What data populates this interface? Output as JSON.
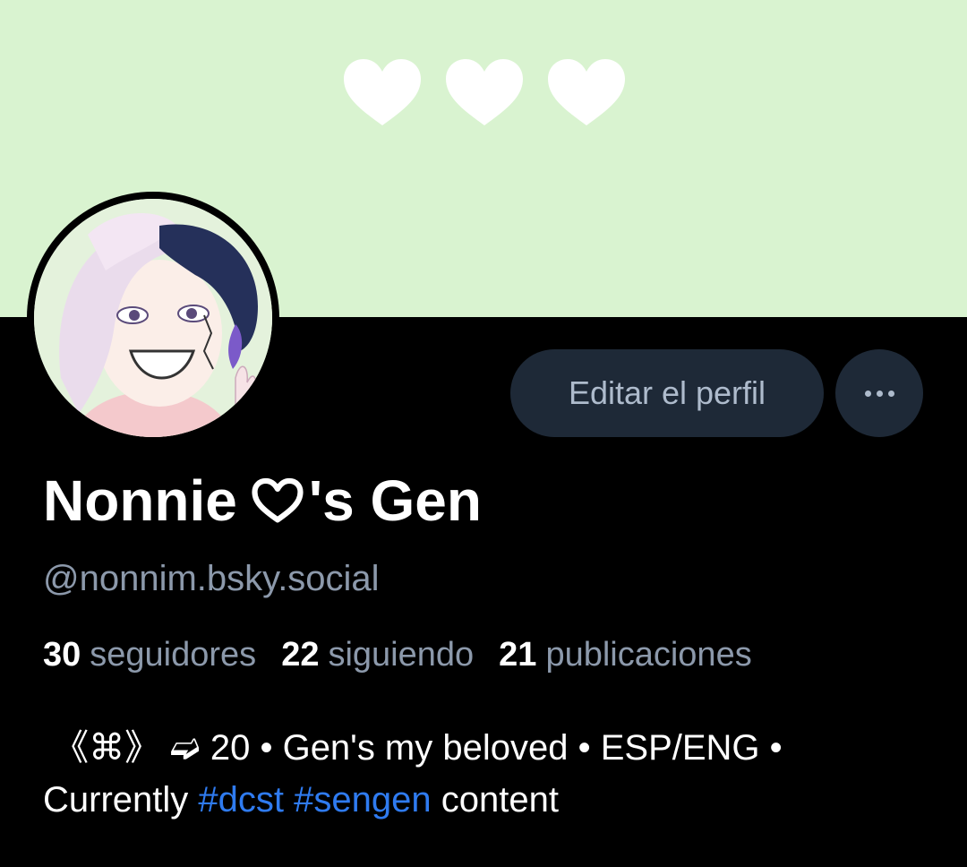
{
  "banner": {
    "color": "#d9f3d0",
    "decorations": [
      "heart-icon",
      "heart-icon",
      "heart-icon"
    ]
  },
  "profile": {
    "display_name_part1": "Nonnie",
    "display_name_icon": "heart-outline-icon",
    "display_name_part2": "'s Gen",
    "handle": "@nonnim.bsky.social"
  },
  "actions": {
    "edit_label": "Editar el perfil",
    "more_icon": "ellipsis-icon"
  },
  "stats": {
    "followers_count": "30",
    "followers_label": "seguidores",
    "following_count": "22",
    "following_label": "siguiendo",
    "posts_count": "21",
    "posts_label": "publicaciones"
  },
  "bio": {
    "line1": " 《⌘》 ➫ 20 • Gen's my beloved • ESP/ENG •",
    "line2_prefix": "Currently ",
    "tag1": "#dcst",
    "tag2": "#sengen",
    "line2_suffix": " content"
  },
  "colors": {
    "background": "#000000",
    "button_bg": "#1e2937",
    "muted_text": "#8c99ab",
    "link": "#2f7bf0"
  }
}
